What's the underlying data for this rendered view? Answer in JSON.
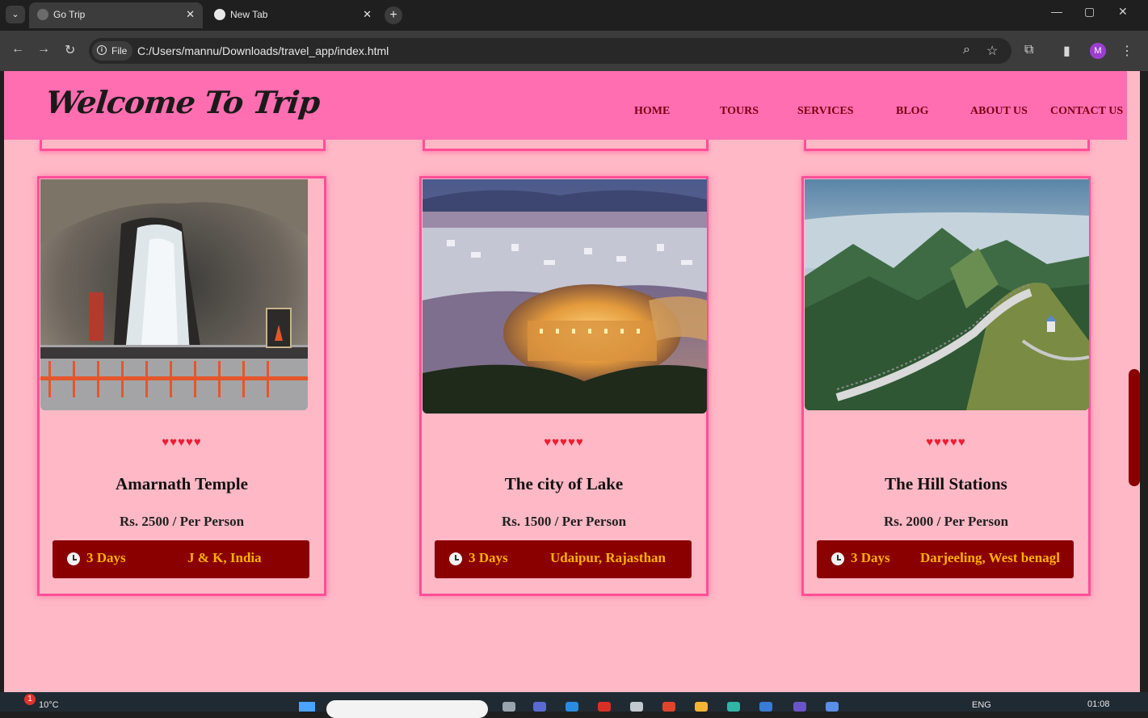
{
  "browser": {
    "tabs": [
      {
        "title": "Go Trip",
        "active": true
      },
      {
        "title": "New Tab",
        "active": false
      }
    ],
    "omnibox": {
      "chip": "File",
      "url": "C:/Users/mannu/Downloads/travel_app/index.html"
    },
    "profile_initial": "M"
  },
  "site": {
    "logo": "Welcome To Trip",
    "nav": [
      "HOME",
      "TOURS",
      "SERVICES",
      "BLOG",
      "ABOUT US",
      "CONTACT US"
    ]
  },
  "cards": [
    {
      "title": "Amarnath Temple",
      "price": "Rs. 2500 / Per Person",
      "days": "3 Days",
      "location": "J & K, India",
      "rating": "♥♥♥♥♥"
    },
    {
      "title": "The city of Lake",
      "price": "Rs. 1500 / Per Person",
      "days": "3 Days",
      "location": "Udaipur, Rajasthan",
      "rating": "♥♥♥♥♥"
    },
    {
      "title": "The Hill Stations",
      "price": "Rs. 2000 / Per Person",
      "days": "3 Days",
      "location": "Darjeeling, West benagl",
      "rating": "♥♥♥♥♥"
    }
  ],
  "taskbar": {
    "weather": "10°C",
    "language": "ENG",
    "time": "01:08",
    "weather_badge": "1"
  },
  "colors": {
    "header": "#ff6eb0",
    "page": "#ffb8c6",
    "infobar": "#8a0000",
    "accent": "#ffb000"
  }
}
